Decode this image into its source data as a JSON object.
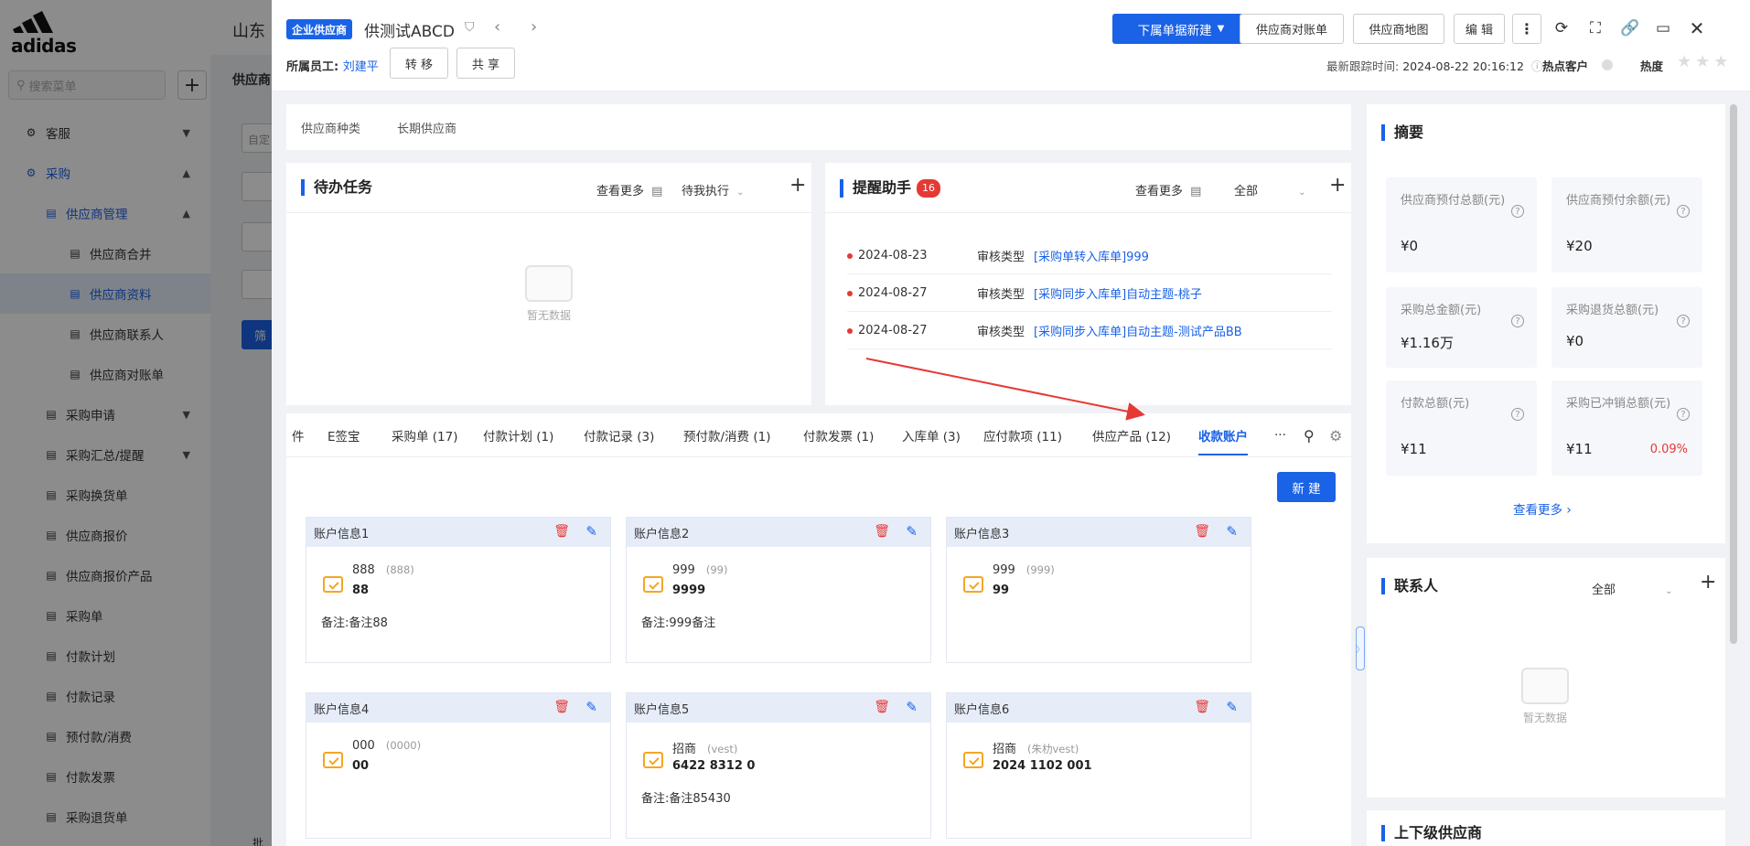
{
  "sidebar": {
    "logo_text": "adidas",
    "search_placeholder": "搜索菜单",
    "items": [
      {
        "label": "客服",
        "level": 1,
        "arrow": "⌄"
      },
      {
        "label": "采购",
        "level": 1,
        "arrow": "⌃",
        "open": true
      },
      {
        "label": "供应商管理",
        "level": 2,
        "arrow": "⌃",
        "open": true
      },
      {
        "label": "供应商合并",
        "level": 3
      },
      {
        "label": "供应商资料",
        "level": 3,
        "active": true
      },
      {
        "label": "供应商联系人",
        "level": 3
      },
      {
        "label": "供应商对账单",
        "level": 3
      },
      {
        "label": "采购申请",
        "level": 2,
        "arrow": "⌄"
      },
      {
        "label": "采购汇总/提醒",
        "level": 2,
        "arrow": "⌄"
      },
      {
        "label": "采购换货单",
        "level": 2
      },
      {
        "label": "供应商报价",
        "level": 2
      },
      {
        "label": "供应商报价产品",
        "level": 2
      },
      {
        "label": "采购单",
        "level": 2
      },
      {
        "label": "付款计划",
        "level": 2
      },
      {
        "label": "付款记录",
        "level": 2
      },
      {
        "label": "预付款/消费",
        "level": 2
      },
      {
        "label": "付款发票",
        "level": 2
      },
      {
        "label": "采购退货单",
        "level": 2
      }
    ]
  },
  "background": {
    "title": "山东",
    "subtitle": "供应商",
    "field_hint": "自定",
    "filter_label": "筛",
    "bottom_label": "批"
  },
  "header": {
    "badge": "企业供应商",
    "title": "供测试ABCD",
    "owner_label": "所属员工:",
    "owner_name": "刘建平",
    "transfer_btn": "转 移",
    "share_btn": "共 享",
    "new_sub_btn": "下属单据新建",
    "statement_btn": "供应商对账单",
    "map_btn": "供应商地图",
    "edit_btn": "编 辑",
    "follow_label": "最新跟踪时间:",
    "follow_time": "2024-08-22 20:16:12",
    "hot_label": "热点客户",
    "heat_label": "热度",
    "heat_stars": "★★★"
  },
  "tagbar": {
    "items": [
      "供应商种类",
      "长期供应商"
    ]
  },
  "todo": {
    "title": "待办任务",
    "more": "查看更多",
    "filter": "待我执行",
    "empty": "暂无数据"
  },
  "reminder": {
    "title": "提醒助手",
    "count": "16",
    "more": "查看更多",
    "filter": "全部",
    "rows": [
      {
        "date": "2024-08-23",
        "type": "审核类型",
        "link": "[采购单转入库单]999"
      },
      {
        "date": "2024-08-27",
        "type": "审核类型",
        "link": "[采购同步入库单]自动主题-桃子"
      },
      {
        "date": "2024-08-27",
        "type": "审核类型",
        "link": "[采购同步入库单]自动主题-测试产品BB"
      }
    ]
  },
  "tabs": {
    "items": [
      "件",
      "E签宝",
      "采购单 (17)",
      "付款计划 (1)",
      "付款记录 (3)",
      "预付款/消费 (1)",
      "付款发票 (1)",
      "入库单 (3)",
      "应付款项 (11)",
      "供应产品 (12)",
      "收款账户"
    ],
    "active": "收款账户",
    "more": "···"
  },
  "accounts": {
    "new_btn": "新 建",
    "note_prefix": "备注:",
    "cards": [
      {
        "title": "账户信息1",
        "name": "888",
        "alias": "(888)",
        "number": "88",
        "note": "备注88"
      },
      {
        "title": "账户信息2",
        "name": "999",
        "alias": "(99)",
        "number": "9999",
        "note": "999备注"
      },
      {
        "title": "账户信息3",
        "name": "999",
        "alias": "(999)",
        "number": "99",
        "note": ""
      },
      {
        "title": "账户信息4",
        "name": "000",
        "alias": "(0000)",
        "number": "00",
        "note": ""
      },
      {
        "title": "账户信息5",
        "name": "招商",
        "alias": "(vest)",
        "number": "6422 8312 0",
        "note": "备注85430"
      },
      {
        "title": "账户信息6",
        "name": "招商",
        "alias": "(朱朸vest)",
        "number": "2024 1102 001",
        "note": ""
      }
    ]
  },
  "summary": {
    "title": "摘要",
    "stats": [
      {
        "label": "供应商预付总额(元)",
        "value": "¥0"
      },
      {
        "label": "供应商预付余额(元)",
        "value": "¥20"
      },
      {
        "label": "采购总金额(元)",
        "value": "¥1.16万"
      },
      {
        "label": "采购退货总额(元)",
        "value": "¥0"
      },
      {
        "label": "付款总额(元)",
        "value": "¥11"
      },
      {
        "label": "采购已冲销总额(元)",
        "value": "¥11",
        "pct": "0.09%"
      }
    ],
    "more": "查看更多"
  },
  "contact": {
    "title": "联系人",
    "filter": "全部",
    "empty": "暂无数据"
  },
  "updown": {
    "title": "上下级供应商"
  },
  "colors": {
    "primary": "#1a62e6",
    "danger": "#e53935",
    "wallet": "#f5a623"
  }
}
